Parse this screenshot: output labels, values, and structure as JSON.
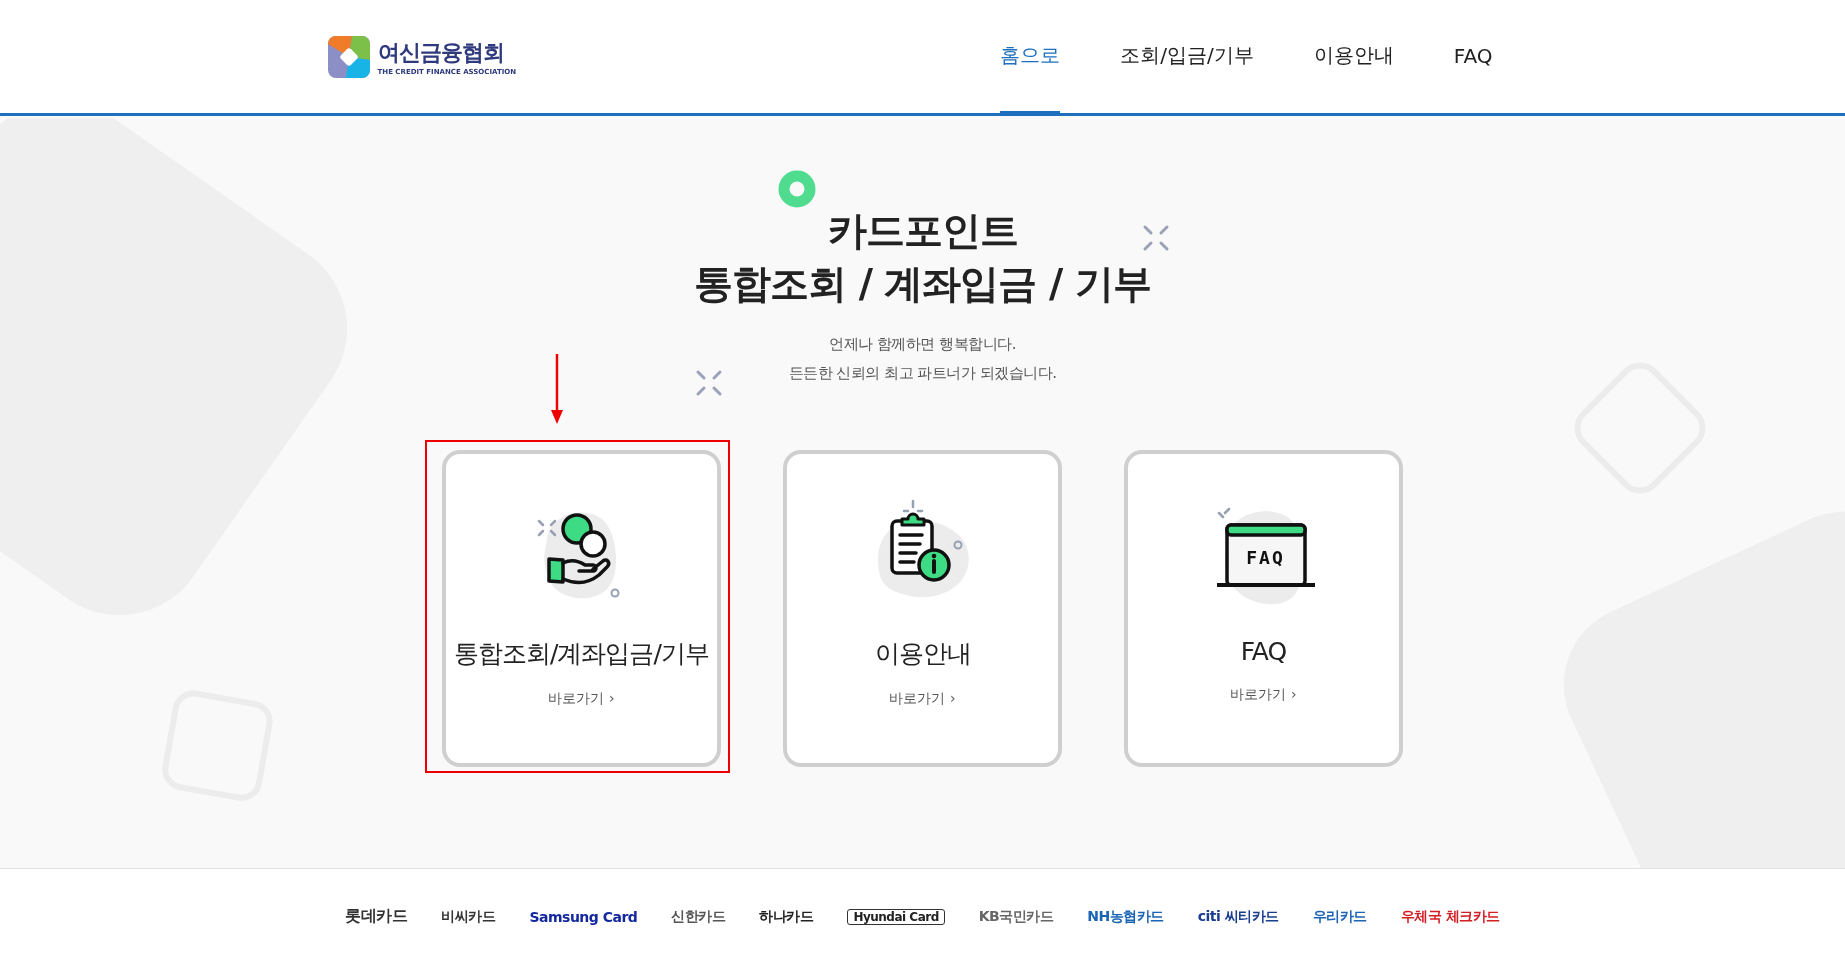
{
  "header": {
    "logo": {
      "name": "여신금융협회",
      "subtitle": "THE CREDIT FINANCE ASSOCIATION"
    },
    "nav": [
      {
        "label": "홈으로",
        "selected": true
      },
      {
        "label": "조회/입금/기부",
        "selected": false
      },
      {
        "label": "이용안내",
        "selected": false
      },
      {
        "label": "FAQ",
        "selected": false
      }
    ]
  },
  "hero": {
    "title_lines": [
      "카드포인트",
      "통합조회 / 계좌입금 / 기부"
    ],
    "subtitle_lines": [
      "언제나 함께하면 행복합니다.",
      "든든한 신뢰의 최고 파트너가 되겠습니다."
    ]
  },
  "cards": [
    {
      "kind": "hand-coin",
      "title": "통합조회/계좌입금/기부",
      "link": "바로가기 ›",
      "highlighted": true
    },
    {
      "kind": "clipboard-info",
      "title": "이용안내",
      "link": "바로가기 ›",
      "highlighted": false
    },
    {
      "kind": "faq-window",
      "icon_label": "FAQ",
      "title": "FAQ",
      "link": "바로가기 ›",
      "highlighted": false
    }
  ],
  "footer": {
    "brands": [
      {
        "label": "롯데카드",
        "color": "#333333"
      },
      {
        "label": "비씨카드",
        "color": "#333333"
      },
      {
        "label": "Samsung Card",
        "color": "#1428a0"
      },
      {
        "label": "신한카드",
        "color": "#555555"
      },
      {
        "label": "하나카드",
        "color": "#222222"
      },
      {
        "label": "Hyundai Card",
        "color": "#222222"
      },
      {
        "label": "KB국민카드",
        "color": "#666666"
      },
      {
        "label": "NH농협카드",
        "color": "#1a64b4"
      },
      {
        "label": "citi 씨티카드",
        "color": "#1a3d8f"
      },
      {
        "label": "우리카드",
        "color": "#1e63b6"
      },
      {
        "label": "우체국 체크카드",
        "color": "#d32027"
      }
    ]
  }
}
